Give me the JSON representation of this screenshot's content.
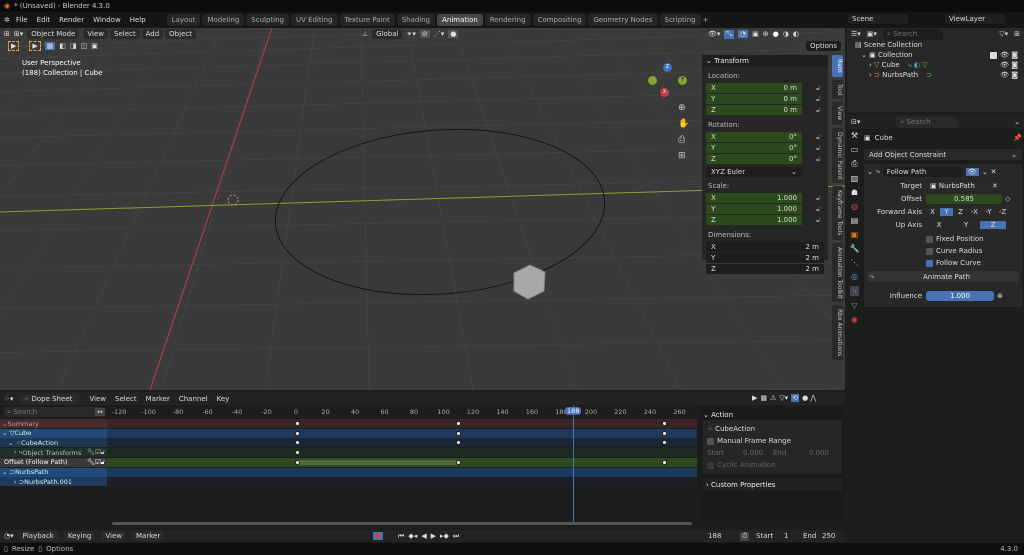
{
  "window": {
    "title": "* (Unsaved) - Blender 4.3.0"
  },
  "menu": [
    "File",
    "Edit",
    "Render",
    "Window",
    "Help"
  ],
  "workspaces": [
    {
      "label": "Layout"
    },
    {
      "label": "Modeling"
    },
    {
      "label": "Sculpting"
    },
    {
      "label": "UV Editing"
    },
    {
      "label": "Texture Paint"
    },
    {
      "label": "Shading"
    },
    {
      "label": "Animation",
      "active": true
    },
    {
      "label": "Rendering"
    },
    {
      "label": "Compositing"
    },
    {
      "label": "Geometry Nodes"
    },
    {
      "label": "Scripting"
    }
  ],
  "viewport": {
    "mode": "Object Mode",
    "menus": [
      "View",
      "Select",
      "Add",
      "Object"
    ],
    "orientation": "Global",
    "options_label": "Options",
    "info_line1": "User Perspective",
    "info_line2": "(188) Collection | Cube",
    "gizmo_axes": {
      "x": "X",
      "y": "Y",
      "z": "Z"
    },
    "axis_colors": {
      "x": "#c43b47",
      "y": "#87a62e",
      "z": "#3b73c4"
    }
  },
  "npanel": {
    "header": "Transform",
    "location_label": "Location:",
    "location": [
      {
        "axis": "X",
        "value": "0 m"
      },
      {
        "axis": "Y",
        "value": "0 m"
      },
      {
        "axis": "Z",
        "value": "0 m"
      }
    ],
    "rotation_label": "Rotation:",
    "rotation": [
      {
        "axis": "X",
        "value": "0°"
      },
      {
        "axis": "Y",
        "value": "0°"
      },
      {
        "axis": "Z",
        "value": "0°"
      }
    ],
    "rotation_mode": "XYZ Euler",
    "scale_label": "Scale:",
    "scale": [
      {
        "axis": "X",
        "value": "1.000"
      },
      {
        "axis": "Y",
        "value": "1.000"
      },
      {
        "axis": "Z",
        "value": "1.000"
      }
    ],
    "dimensions_label": "Dimensions:",
    "dimensions": [
      {
        "axis": "X",
        "value": "2 m"
      },
      {
        "axis": "Y",
        "value": "2 m"
      },
      {
        "axis": "Z",
        "value": "2 m"
      }
    ],
    "tabs": [
      {
        "label": "Item",
        "active": true
      },
      {
        "label": "Tool"
      },
      {
        "label": "View"
      },
      {
        "label": "Dynamic Parent"
      },
      {
        "label": "Keyframe Tools"
      },
      {
        "label": "Animation Toolkit"
      },
      {
        "label": "Rbx Animations"
      }
    ]
  },
  "outliner": {
    "scene": "Scene",
    "view_layer": "ViewLayer",
    "search_placeholder": "Search",
    "items": [
      {
        "label": "Scene Collection",
        "depth": 0
      },
      {
        "label": "Collection",
        "depth": 1
      },
      {
        "label": "Cube",
        "depth": 2
      },
      {
        "label": "NurbsPath",
        "depth": 2
      }
    ]
  },
  "properties": {
    "search_placeholder": "Search",
    "object_name": "Cube",
    "add_constraint": "Add Object Constraint",
    "constraint": {
      "name": "Follow Path",
      "target_label": "Target",
      "target": "NurbsPath",
      "offset_label": "Offset",
      "offset": "0.585",
      "forward_axis_label": "Forward Axis",
      "forward_axis": [
        "X",
        "Y",
        "Z",
        "-X",
        "-Y",
        "-Z"
      ],
      "forward_selected": "Y",
      "up_axis_label": "Up Axis",
      "up_axis": [
        "X",
        "Y",
        "Z"
      ],
      "up_selected": "Z",
      "fixed_position": "Fixed Position",
      "fixed_position_on": false,
      "curve_radius": "Curve Radius",
      "curve_radius_on": false,
      "follow_curve": "Follow Curve",
      "follow_curve_on": true,
      "animate_path": "Animate Path",
      "influence_label": "Influence",
      "influence": "1.000"
    }
  },
  "dopesheet": {
    "mode": "Dope Sheet",
    "menus": [
      "View",
      "Select",
      "Marker",
      "Channel",
      "Key"
    ],
    "search_placeholder": "Search",
    "ticks": [
      "-120",
      "-100",
      "-80",
      "-60",
      "-40",
      "-20",
      "0",
      "20",
      "40",
      "60",
      "80",
      "100",
      "120",
      "140",
      "160",
      "180",
      "200",
      "220",
      "240",
      "260"
    ],
    "current_frame": "188",
    "channels": [
      {
        "label": "Summary",
        "keys": [
          1,
          110,
          250
        ]
      },
      {
        "label": "Cube",
        "keys": [
          1,
          110,
          250
        ]
      },
      {
        "label": "CubeAction",
        "keys": [
          1,
          110,
          250
        ]
      },
      {
        "label": "Object Transforms",
        "keys": [
          1
        ]
      },
      {
        "label": "Offset (Follow Path)",
        "keys": [
          1,
          110,
          250
        ]
      },
      {
        "label": "NurbsPath",
        "keys": []
      },
      {
        "label": "NurbsPath.001",
        "keys": []
      }
    ],
    "sidebar": {
      "action_header": "Action",
      "action_name": "CubeAction",
      "manual_frame_range": "Manual Frame Range",
      "start_label": "Start",
      "start": "0.000",
      "end_label": "End",
      "end": "0.000",
      "cyclic": "Cyclic Animation",
      "custom_properties": "Custom Properties"
    }
  },
  "timeline": {
    "menus": [
      "Playback",
      "Keying",
      "View",
      "Marker"
    ],
    "current_frame": "188",
    "start_label": "Start",
    "start": "1",
    "end_label": "End",
    "end": "250"
  },
  "statusbar": {
    "resize": "Resize",
    "options": "Options",
    "version": "4.3.0"
  }
}
